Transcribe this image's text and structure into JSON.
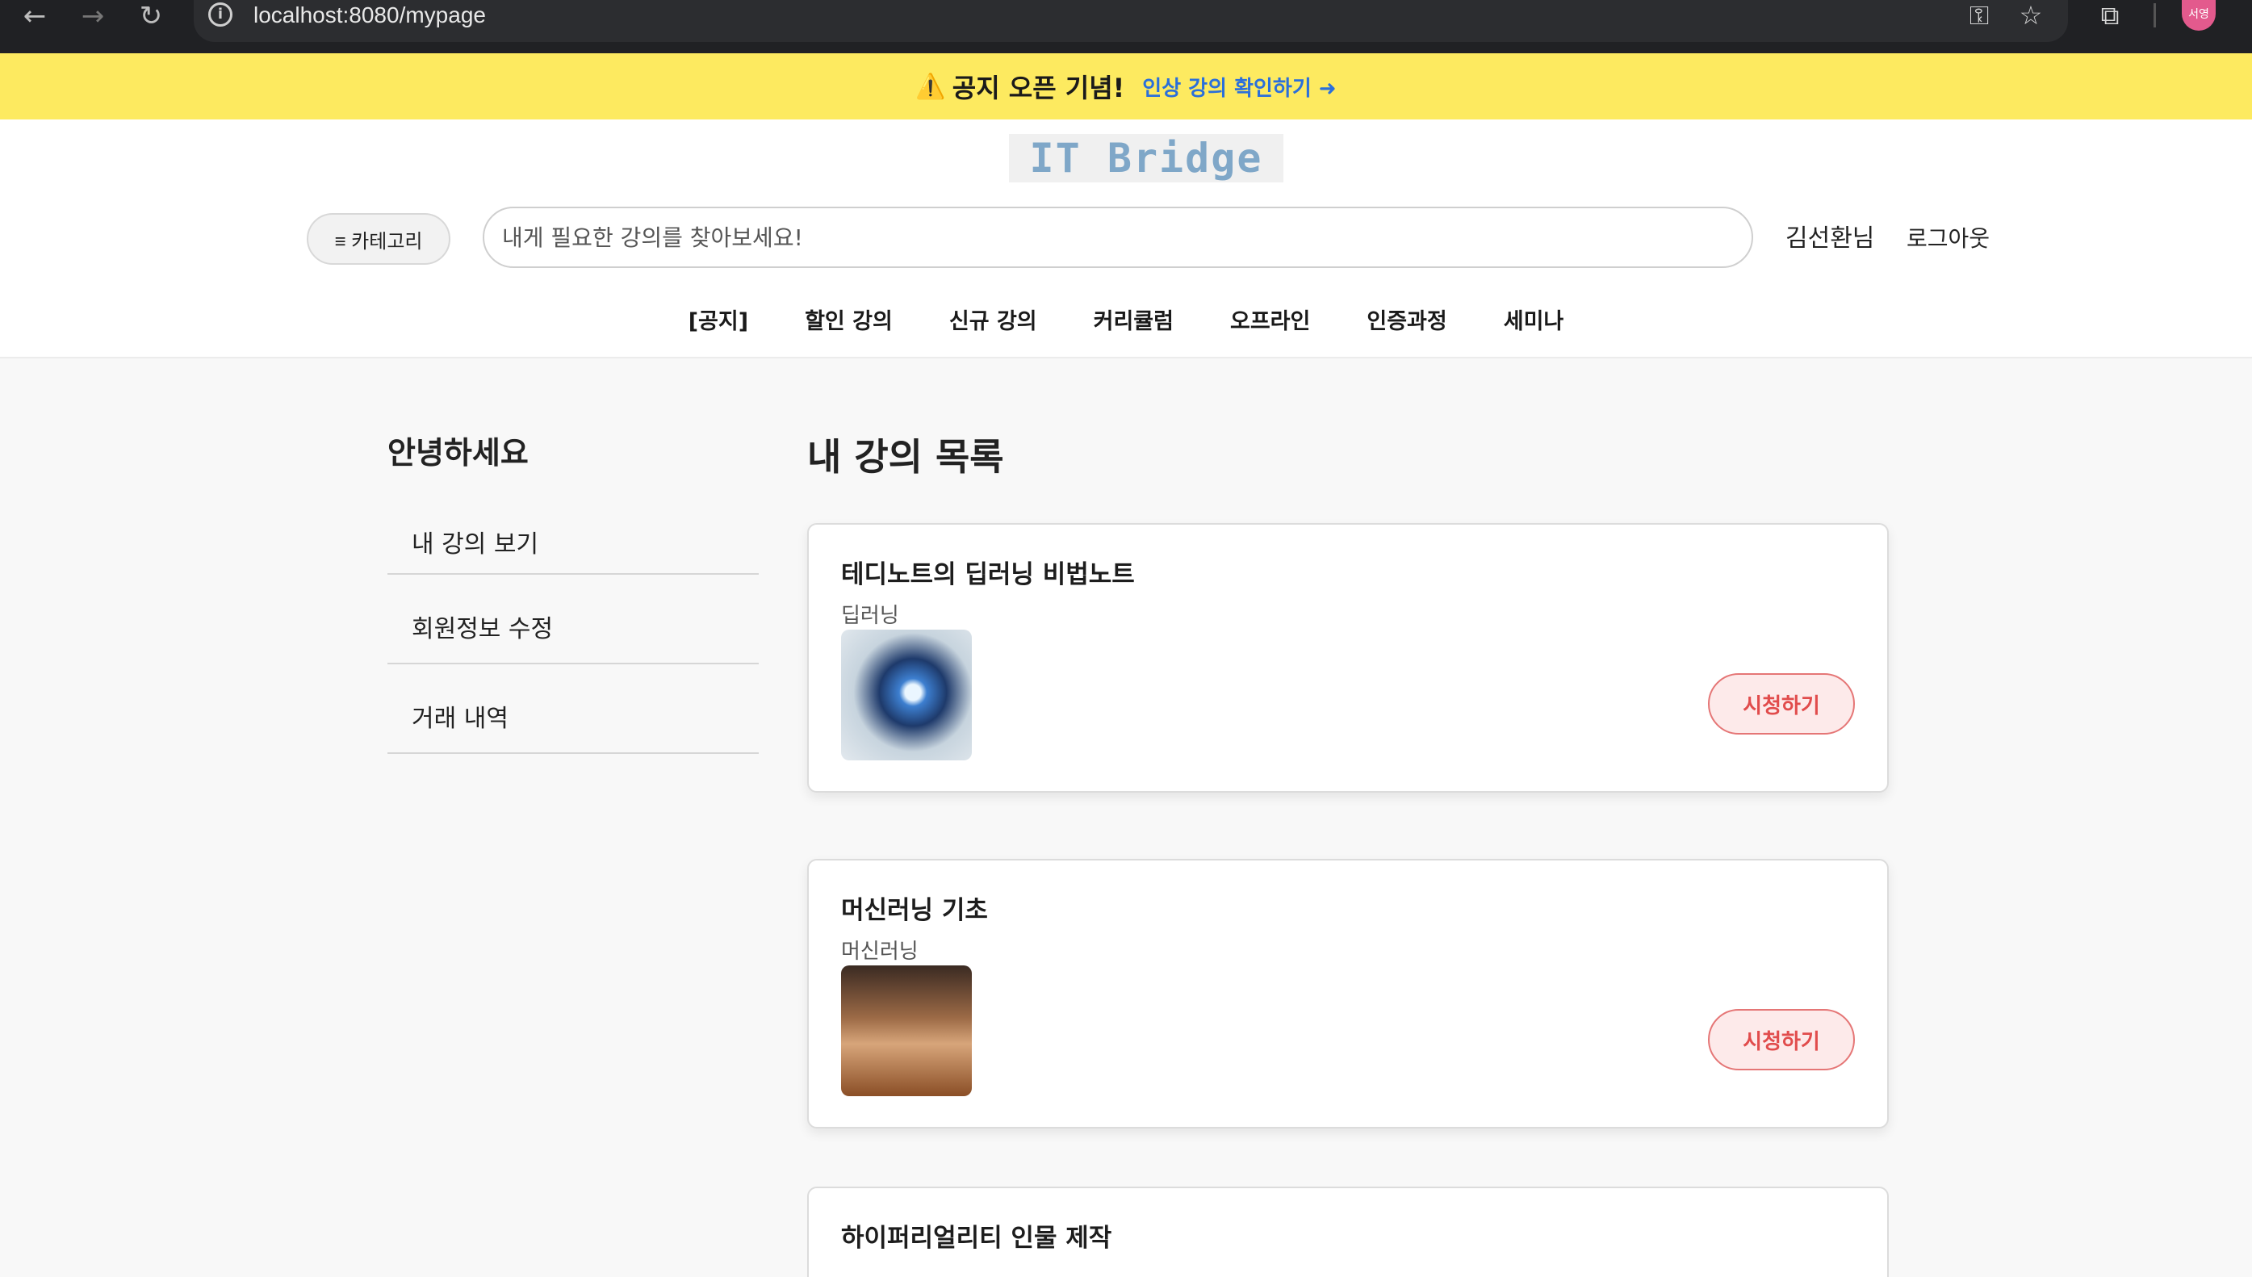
{
  "browser": {
    "url": "localhost:8080/mypage",
    "profile_label": "서영"
  },
  "banner": {
    "icon": "warning-icon",
    "title": "공지 오픈 기념!",
    "link": "인상 강의 확인하기 ➜"
  },
  "header": {
    "logo_text": "IT Bridge",
    "category_label": "≡ 카테고리",
    "search_placeholder": "내게 필요한 강의를 찾아보세요!",
    "user_name": "김선환님",
    "logout_label": "로그아웃",
    "nav": [
      "[공지]",
      "할인 강의",
      "신규 강의",
      "커리큘럼",
      "오프라인",
      "인증과정",
      "세미나"
    ]
  },
  "sidebar": {
    "greeting": "안녕하세요",
    "items": [
      "내 강의 보기",
      "회원정보 수정",
      "거래 내역"
    ]
  },
  "main": {
    "title": "내 강의 목록",
    "courses": [
      {
        "title": "테디노트의 딥러닝 비법노트",
        "category": "딥러닝",
        "button": "시청하기"
      },
      {
        "title": "머신러닝 기초",
        "category": "머신러닝",
        "button": "시청하기"
      },
      {
        "title": "하이퍼리얼리티 인물 제작"
      }
    ]
  }
}
